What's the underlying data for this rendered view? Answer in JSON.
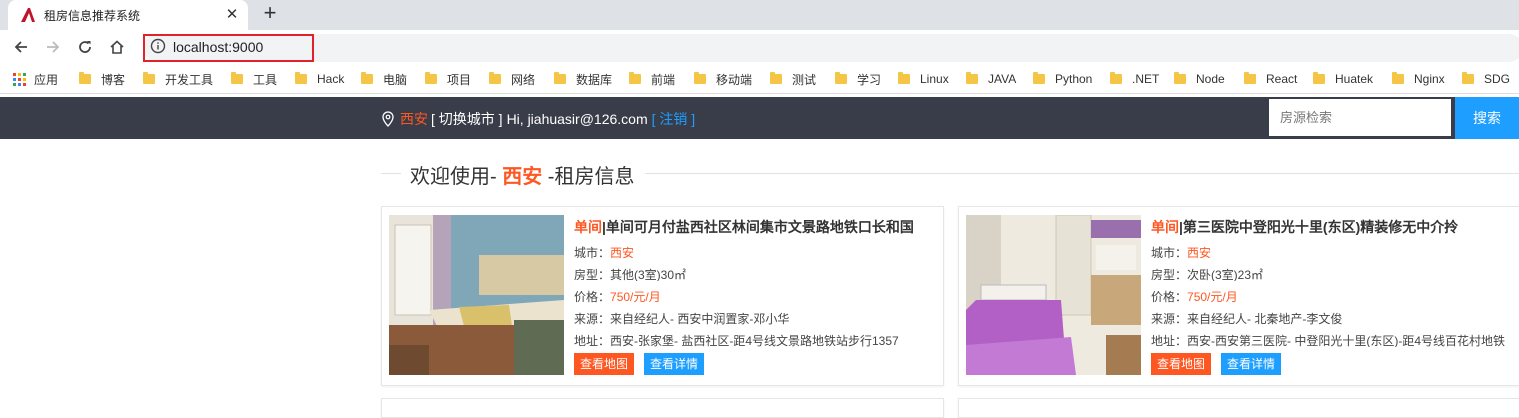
{
  "browser": {
    "tab_title": "租房信息推荐系统",
    "url": "localhost:9000",
    "bookmarks": [
      "应用",
      "博客",
      "开发工具",
      "工具",
      "Hack",
      "电脑",
      "项目",
      "网络",
      "数据库",
      "前端",
      "移动端",
      "测试",
      "学习",
      "Linux",
      "JAVA",
      "Python",
      ".NET",
      "Node",
      "React",
      "Huatek",
      "Nginx",
      "SDG"
    ]
  },
  "header": {
    "city": "西安",
    "switch_city": "[ 切换城市 ]",
    "greeting": "Hi, jiahuasir@126.com",
    "logout": "[ 注销 ]",
    "search_placeholder": "房源检索",
    "search_button": "搜索"
  },
  "welcome": {
    "prefix": "欢迎使用-",
    "city": "西安",
    "suffix": "-租房信息"
  },
  "labels": {
    "city": "城市：",
    "type": "房型：",
    "price": "价格：",
    "source": "来源：",
    "address": "地址：",
    "view_map": "查看地图",
    "view_detail": "查看详情"
  },
  "listings": [
    {
      "kind": "单间",
      "title": "|单间可月付盐西社区林间集市文景路地铁口长和国",
      "city": "西安",
      "type": "其他(3室)30㎡",
      "price": "750/元/月",
      "source": "来自经纪人- 西安中润置家-邓小华",
      "address": "西安-张家堡- 盐西社区-距4号线文景路地铁站步行1357"
    },
    {
      "kind": "单间",
      "title": "|第三医院中登阳光十里(东区)精装修无中介拎",
      "city": "西安",
      "type": "次卧(3室)23㎡",
      "price": "750/元/月",
      "source": "来自经纪人- 北秦地产-李文俊",
      "address": "西安-西安第三医院- 中登阳光十里(东区)-距4号线百花村地铁"
    }
  ]
}
